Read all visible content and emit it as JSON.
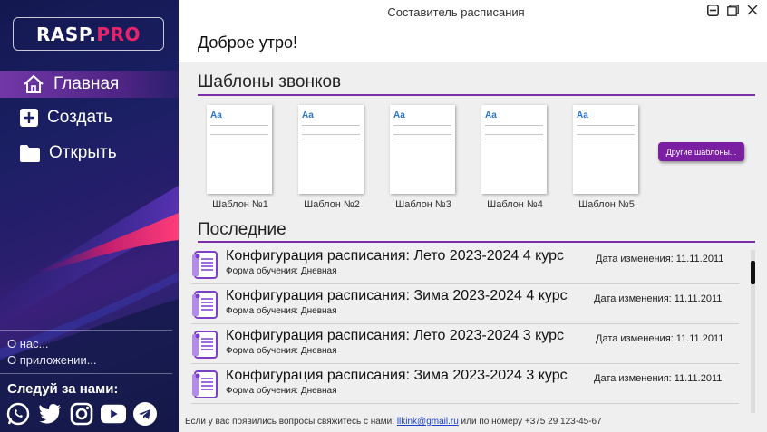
{
  "window": {
    "title": "Составитель расписания"
  },
  "brand": {
    "logo_main": "RASP.",
    "logo_accent": "PRO",
    "accent_color": "#e8236a"
  },
  "sidebar": {
    "nav": [
      {
        "label": "Главная",
        "icon": "home-icon"
      },
      {
        "label": "Создать",
        "icon": "plus-square-icon"
      },
      {
        "label": "Открыть",
        "icon": "folder-icon"
      }
    ],
    "links": [
      "О нас...",
      "О приложении..."
    ],
    "follow_label": "Следуй за нами:",
    "socials": [
      "whatsapp-icon",
      "twitter-icon",
      "instagram-icon",
      "youtube-icon",
      "telegram-icon"
    ]
  },
  "header": {
    "greeting": "Доброе утро!"
  },
  "templates": {
    "title": "Шаблоны звонков",
    "items": [
      "Шаблон №1",
      "Шаблон №2",
      "Шаблон №3",
      "Шаблон №4",
      "Шаблон №5"
    ],
    "page_label": "Aa",
    "more_button": "Другие шаблоны..."
  },
  "recent": {
    "title": "Последние",
    "items": [
      {
        "name": "Конфигурация расписания: Лето 2023-2024 4 курс",
        "form": "Форма обучения: Дневная",
        "date": "Дата изменения: 11.11.2011"
      },
      {
        "name": "Конфигурация расписания: Зима 2023-2024 4 курс",
        "form": "Форма обучения: Дневная",
        "date": "Дата изменения: 11.11.2011"
      },
      {
        "name": "Конфигурация расписания: Лето 2023-2024 3 курс",
        "form": "Форма обучения: Дневная",
        "date": "Дата изменения: 11.11.2011"
      },
      {
        "name": "Конфигурация расписания: Зима 2023-2024 3 курс",
        "form": "Форма обучения: Дневная",
        "date": "Дата изменения: 11.11.2011"
      }
    ]
  },
  "footer": {
    "text_before": "Если у вас появились вопросы свяжитесь с нами: ",
    "email": "llkink@gmail.ru",
    "text_after": " или по номеру +375 29 123-45-67"
  },
  "colors": {
    "accent_purple": "#7a1fa2",
    "sidebar_bg": "#1a1f63"
  }
}
